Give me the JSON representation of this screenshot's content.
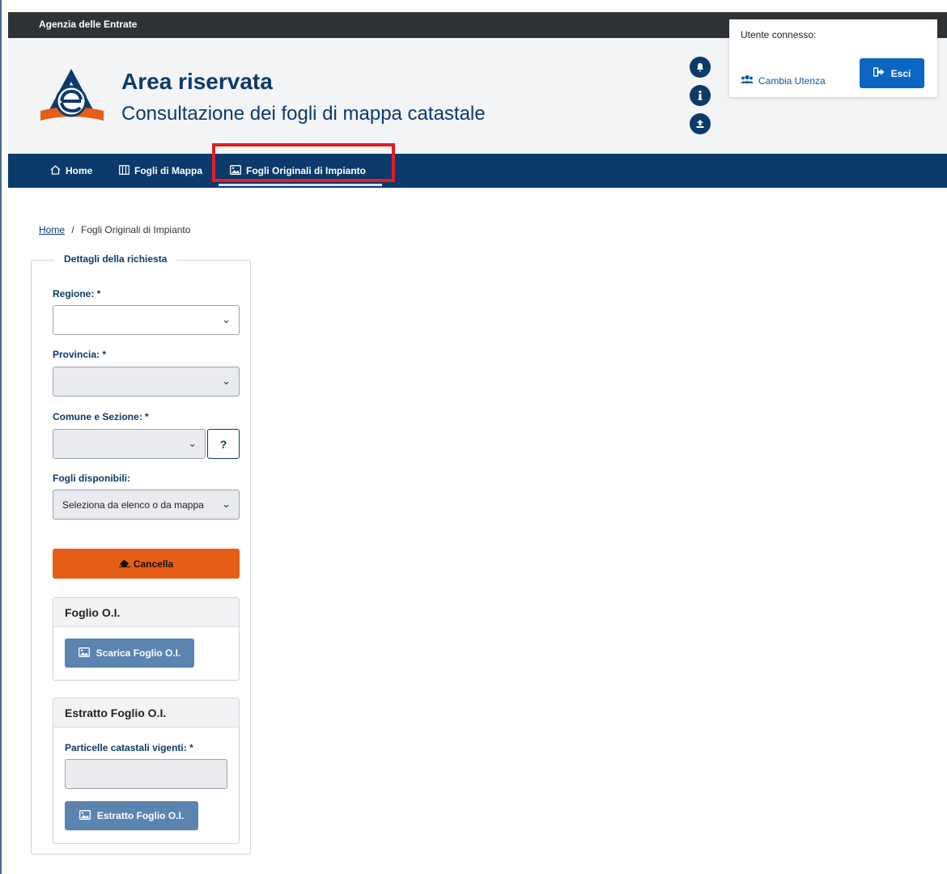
{
  "topbar": {
    "agency": "Agenzia delle Entrate"
  },
  "header": {
    "title": "Area riservata",
    "subtitle": "Consultazione dei fogli di mappa catastale",
    "icons": [
      "bell-icon",
      "info-icon",
      "upload-icon"
    ]
  },
  "user": {
    "label": "Utente connesso:",
    "switch_label": "Cambia Utenza",
    "logout_label": "Esci"
  },
  "nav": {
    "items": [
      {
        "label": "Home",
        "icon": "home-icon"
      },
      {
        "label": "Fogli di Mappa",
        "icon": "map-columns-icon"
      },
      {
        "label": "Fogli Originali di Impianto",
        "icon": "image-icon",
        "active": true
      }
    ]
  },
  "breadcrumb": {
    "home": "Home",
    "separator": "/",
    "current": "Fogli Originali di Impianto"
  },
  "form": {
    "legend": "Dettagli della richiesta",
    "regione_label": "Regione: *",
    "regione_value": "",
    "provincia_label": "Provincia: *",
    "provincia_value": "",
    "comune_label": "Comune e Sezione: *",
    "comune_value": "",
    "help_label": "?",
    "fogli_label": "Fogli disponibili:",
    "fogli_value": "Seleziona da elenco o da mappa",
    "cancel_label": "Cancella"
  },
  "foglio_card": {
    "title": "Foglio O.I.",
    "button_label": "Scarica Foglio O.I."
  },
  "estratto_card": {
    "title": "Estratto Foglio O.I.",
    "field_label": "Particelle catastali vigenti: *",
    "field_value": "",
    "button_label": "Estratto Foglio O.I."
  },
  "colors": {
    "brand_dark": "#0b3a6b",
    "accent_orange": "#e65d16",
    "highlight_red": "#e01e24"
  }
}
